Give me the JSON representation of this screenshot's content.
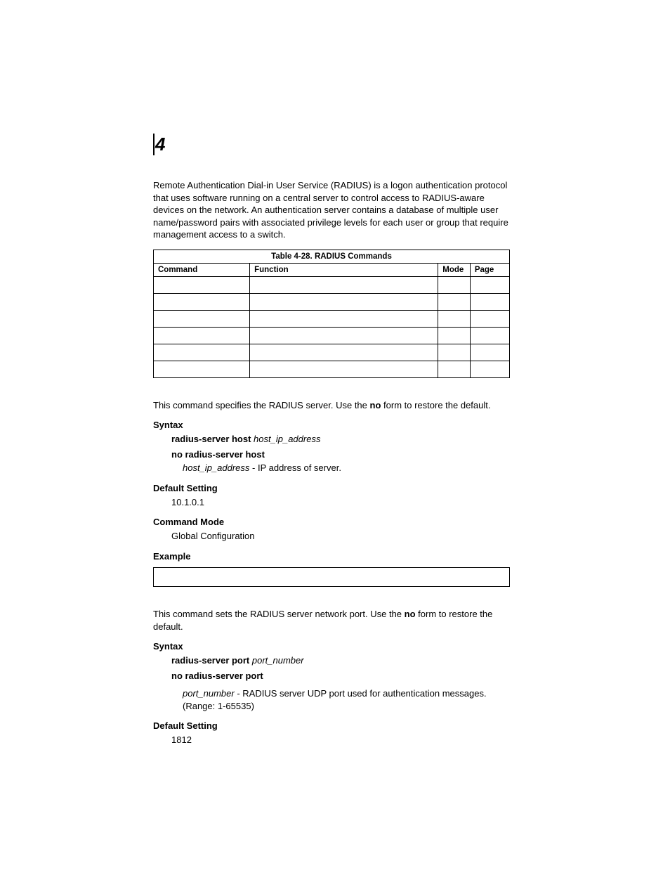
{
  "chapter": "4",
  "intro": {
    "p1a": "Remote Authentication Dial-in User Service (RADIUS) is a logon authentication protocol that uses software running on a central server to control access to RADIUS-aware devices on the network. An authentication server contains a database of multiple user name/password pairs with associated privilege levels for each user or group that require management access to a switch."
  },
  "table": {
    "title": "Table 4-28.  RADIUS Commands",
    "headers": {
      "command": "Command",
      "function": "Function",
      "mode": "Mode",
      "page": "Page"
    }
  },
  "host": {
    "desc_a": "This command specifies the RADIUS server. Use the ",
    "desc_no": "no",
    "desc_b": " form to restore the default.",
    "syntax_label": "Syntax",
    "syntax1_cmd": "radius-server host ",
    "syntax1_arg": "host_ip_address",
    "syntax2": "no radius-server host",
    "arg_name": "host_ip_address",
    "arg_desc": " - IP address of server.",
    "default_label": "Default Setting",
    "default_value": "10.1.0.1",
    "mode_label": "Command Mode",
    "mode_value": "Global Configuration",
    "example_label": "Example"
  },
  "port": {
    "desc_a": "This command sets the RADIUS server network port. Use the ",
    "desc_no": "no",
    "desc_b": " form to restore the default.",
    "syntax_label": "Syntax",
    "syntax1_cmd": "radius-server port ",
    "syntax1_arg": "port_number",
    "syntax2": "no radius-server port",
    "arg_name": "port_number",
    "arg_desc": " - RADIUS server UDP port used for authentication messages. (Range: 1-65535)",
    "default_label": "Default Setting",
    "default_value": "1812"
  }
}
